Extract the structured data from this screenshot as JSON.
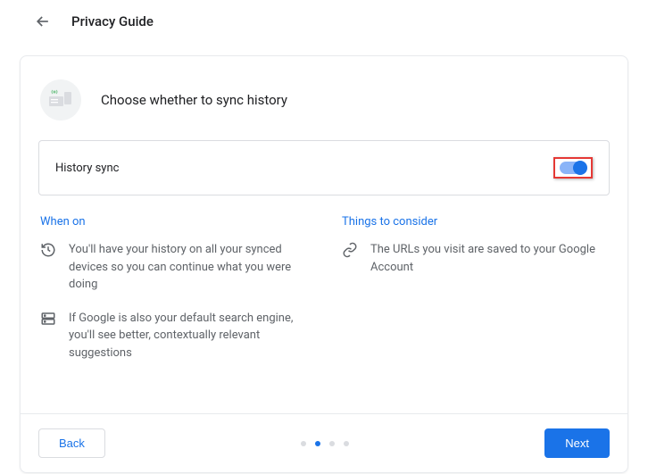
{
  "header": {
    "title": "Privacy Guide"
  },
  "hero": {
    "title": "Choose whether to sync history"
  },
  "setting": {
    "label": "History sync",
    "enabled": true
  },
  "when_on": {
    "title": "When on",
    "items": [
      "You'll have your history on all your synced devices so you can continue what you were doing",
      "If Google is also your default search engine, you'll see better, contextually relevant suggestions"
    ]
  },
  "consider": {
    "title": "Things to consider",
    "items": [
      "The URLs you visit are saved to your Google Account"
    ]
  },
  "footer": {
    "back": "Back",
    "next": "Next",
    "step_active": 1,
    "step_count": 4
  }
}
